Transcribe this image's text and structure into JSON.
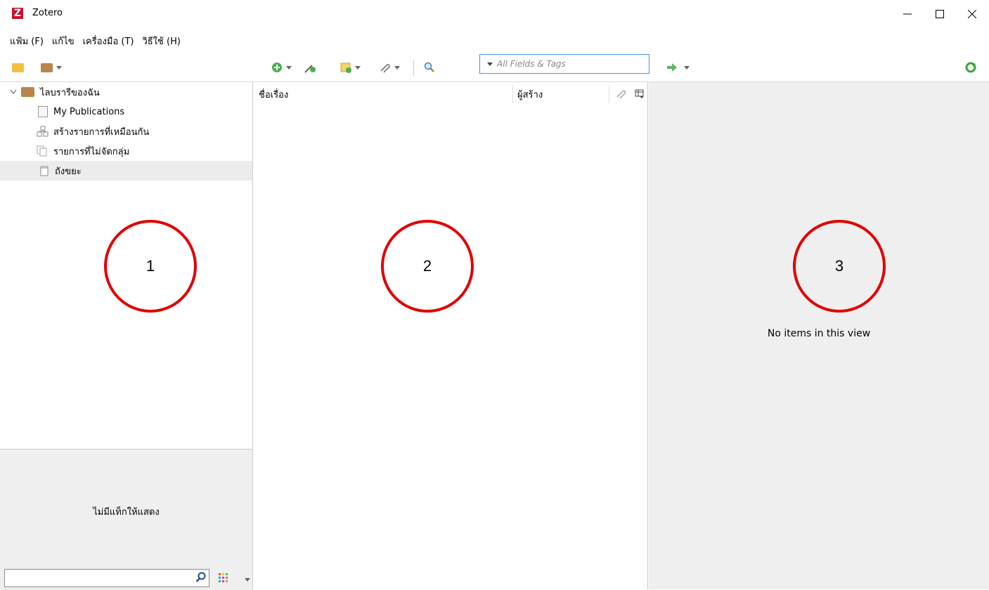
{
  "window": {
    "title": "Zotero",
    "logo_letter": "Z"
  },
  "menu": [
    {
      "label": "แฟ้ม (F)"
    },
    {
      "label": "แก้ไข"
    },
    {
      "label": "เครื่องมือ (T)"
    },
    {
      "label": "วิธีใช้ (H)"
    }
  ],
  "search": {
    "placeholder": "All Fields & Tags"
  },
  "collections": [
    {
      "label": "ไลบรารีของฉัน",
      "icon": "library-icon"
    },
    {
      "label": "My Publications",
      "icon": "publications-icon"
    },
    {
      "label": "สร้างรายการที่เหมือนกัน",
      "icon": "duplicates-icon"
    },
    {
      "label": "รายการที่ไม่จัดกลุ่ม",
      "icon": "unfiled-icon"
    },
    {
      "label": "ถังขยะ",
      "icon": "trash-icon",
      "selected": true
    }
  ],
  "tags": {
    "empty_message": "ไม่มีแท็กให้แสดง"
  },
  "items": {
    "columns": [
      {
        "label": "ชื่อเรื่อง"
      },
      {
        "label": "ผู้สร้าง"
      }
    ]
  },
  "item_pane": {
    "empty_message": "No items in this view"
  },
  "annotations": {
    "circle_1": "1",
    "circle_2": "2",
    "circle_3": "3"
  },
  "colors": {
    "annotation": "#e00000",
    "logo": "#c8102e",
    "accent": "#4a90e2",
    "sync": "#3aa33a"
  }
}
